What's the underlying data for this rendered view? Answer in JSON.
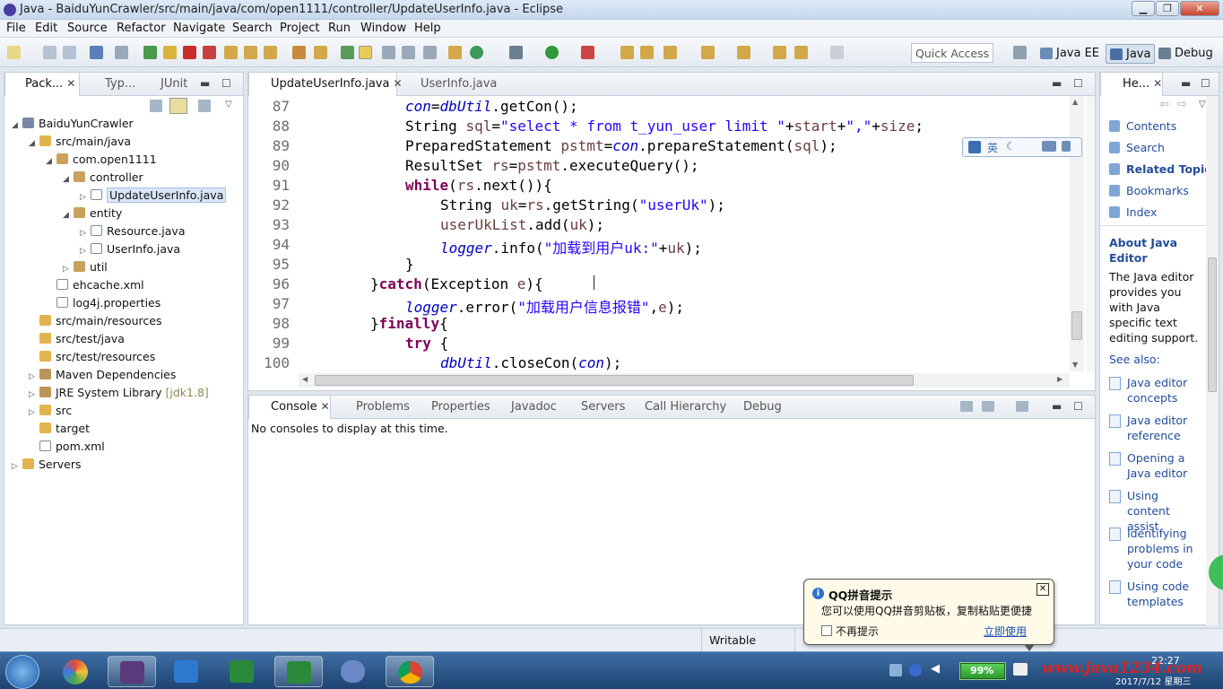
{
  "window": {
    "title": "Java - BaiduYunCrawler/src/main/java/com/open1111/controller/UpdateUserInfo.java - Eclipse"
  },
  "menu": [
    "File",
    "Edit",
    "Source",
    "Refactor",
    "Navigate",
    "Search",
    "Project",
    "Run",
    "Window",
    "Help"
  ],
  "toolbar": {
    "quick_access": "Quick Access",
    "perspectives": [
      "Java EE",
      "Java",
      "Debug"
    ]
  },
  "explorer": {
    "tabs": [
      "Pack...",
      "Typ...",
      "JUnit"
    ],
    "tree": [
      {
        "label": "BaiduYunCrawler",
        "depth": 0,
        "arrow": "open",
        "icon": "proj"
      },
      {
        "label": "src/main/java",
        "depth": 1,
        "arrow": "open",
        "icon": "folder"
      },
      {
        "label": "com.open1111",
        "depth": 2,
        "arrow": "open",
        "icon": "pkg"
      },
      {
        "label": "controller",
        "depth": 3,
        "arrow": "open",
        "icon": "pkg"
      },
      {
        "label": "UpdateUserInfo.java",
        "depth": 4,
        "arrow": "closed",
        "icon": "java",
        "selected": true
      },
      {
        "label": "entity",
        "depth": 3,
        "arrow": "open",
        "icon": "pkg"
      },
      {
        "label": "Resource.java",
        "depth": 4,
        "arrow": "closed",
        "icon": "java"
      },
      {
        "label": "UserInfo.java",
        "depth": 4,
        "arrow": "closed",
        "icon": "java"
      },
      {
        "label": "util",
        "depth": 3,
        "arrow": "closed",
        "icon": "pkg"
      },
      {
        "label": "ehcache.xml",
        "depth": 2,
        "arrow": "none",
        "icon": "xml"
      },
      {
        "label": "log4j.properties",
        "depth": 2,
        "arrow": "none",
        "icon": "xml"
      },
      {
        "label": "src/main/resources",
        "depth": 1,
        "arrow": "none",
        "icon": "folder"
      },
      {
        "label": "src/test/java",
        "depth": 1,
        "arrow": "none",
        "icon": "folder"
      },
      {
        "label": "src/test/resources",
        "depth": 1,
        "arrow": "none",
        "icon": "folder"
      },
      {
        "label": "Maven Dependencies",
        "depth": 1,
        "arrow": "closed",
        "icon": "lib"
      },
      {
        "label": "JRE System Library",
        "depth": 1,
        "arrow": "closed",
        "icon": "lib",
        "suffix": "[jdk1.8]"
      },
      {
        "label": "src",
        "depth": 1,
        "arrow": "closed",
        "icon": "folder"
      },
      {
        "label": "target",
        "depth": 1,
        "arrow": "none",
        "icon": "folder"
      },
      {
        "label": "pom.xml",
        "depth": 1,
        "arrow": "none",
        "icon": "xml"
      },
      {
        "label": "Servers",
        "depth": 0,
        "arrow": "closed",
        "icon": "folder"
      }
    ]
  },
  "editor": {
    "tabs": [
      "UpdateUserInfo.java",
      "UserInfo.java"
    ],
    "lines": [
      {
        "n": "87",
        "i": 3,
        "t": [
          [
            "f",
            "con"
          ],
          [
            "p",
            "="
          ],
          [
            "f",
            "dbUtil"
          ],
          [
            "p",
            ".getCon();"
          ]
        ]
      },
      {
        "n": "88",
        "i": 3,
        "t": [
          [
            "p",
            "String "
          ],
          [
            "v",
            "sql"
          ],
          [
            "p",
            "="
          ],
          [
            "s",
            "\"select * from t_yun_user limit \""
          ],
          [
            "p",
            "+"
          ],
          [
            "v",
            "start"
          ],
          [
            "p",
            "+"
          ],
          [
            "s",
            "\",\""
          ],
          [
            "p",
            "+"
          ],
          [
            "v",
            "size"
          ],
          [
            "p",
            ";"
          ]
        ]
      },
      {
        "n": "89",
        "i": 3,
        "t": [
          [
            "p",
            "PreparedStatement "
          ],
          [
            "v",
            "pstmt"
          ],
          [
            "p",
            "="
          ],
          [
            "f",
            "con"
          ],
          [
            "p",
            ".prepareStatement("
          ],
          [
            "v",
            "sql"
          ],
          [
            "p",
            ");"
          ]
        ]
      },
      {
        "n": "90",
        "i": 3,
        "t": [
          [
            "p",
            "ResultSet "
          ],
          [
            "v",
            "rs"
          ],
          [
            "p",
            "="
          ],
          [
            "v",
            "pstmt"
          ],
          [
            "p",
            ".executeQuery();"
          ]
        ]
      },
      {
        "n": "91",
        "i": 3,
        "t": [
          [
            "k",
            "while"
          ],
          [
            "p",
            "("
          ],
          [
            "v",
            "rs"
          ],
          [
            "p",
            ".next()){"
          ]
        ]
      },
      {
        "n": "92",
        "i": 4,
        "t": [
          [
            "p",
            "String "
          ],
          [
            "v",
            "uk"
          ],
          [
            "p",
            "="
          ],
          [
            "v",
            "rs"
          ],
          [
            "p",
            ".getString("
          ],
          [
            "s",
            "\"userUk\""
          ],
          [
            "p",
            ");"
          ]
        ]
      },
      {
        "n": "93",
        "i": 4,
        "t": [
          [
            "v",
            "userUkList"
          ],
          [
            "p",
            ".add("
          ],
          [
            "v",
            "uk"
          ],
          [
            "p",
            ");"
          ]
        ]
      },
      {
        "n": "94",
        "i": 4,
        "t": [
          [
            "f",
            "logger"
          ],
          [
            "p",
            ".info("
          ],
          [
            "s",
            "\"加载到用户uk:\""
          ],
          [
            "p",
            "+"
          ],
          [
            "v",
            "uk"
          ],
          [
            "p",
            ");"
          ]
        ]
      },
      {
        "n": "95",
        "i": 3,
        "t": [
          [
            "p",
            "}"
          ]
        ]
      },
      {
        "n": "96",
        "i": 2,
        "t": [
          [
            "p",
            "}"
          ],
          [
            "k",
            "catch"
          ],
          [
            "p",
            "(Exception "
          ],
          [
            "v",
            "e"
          ],
          [
            "p",
            "){"
          ]
        ]
      },
      {
        "n": "97",
        "i": 3,
        "t": [
          [
            "f",
            "logger"
          ],
          [
            "p",
            ".error("
          ],
          [
            "s",
            "\"加载用户信息报错\""
          ],
          [
            "p",
            ","
          ],
          [
            "v",
            "e"
          ],
          [
            "p",
            ");"
          ]
        ]
      },
      {
        "n": "98",
        "i": 2,
        "t": [
          [
            "p",
            "}"
          ],
          [
            "k",
            "finally"
          ],
          [
            "p",
            "{"
          ]
        ]
      },
      {
        "n": "99",
        "i": 3,
        "t": [
          [
            "k",
            "try"
          ],
          [
            "p",
            " {"
          ]
        ]
      },
      {
        "n": "100",
        "i": 4,
        "t": [
          [
            "f",
            "dbUtil"
          ],
          [
            "p",
            ".closeCon("
          ],
          [
            "f",
            "con"
          ],
          [
            "p",
            ");"
          ]
        ]
      }
    ]
  },
  "ime_toolbar": {
    "lang": "英"
  },
  "console": {
    "tabs": [
      "Console",
      "Problems",
      "Properties",
      "Javadoc",
      "Servers",
      "Call Hierarchy",
      "Debug"
    ],
    "message": "No consoles to display at this time."
  },
  "help": {
    "tab": "He...",
    "links": [
      "Contents",
      "Search",
      "Related Topics",
      "Bookmarks",
      "Index"
    ],
    "heading": "About Java Editor",
    "body": "The Java editor provides you with Java specific text editing support.",
    "see_also": "See also:",
    "topics": [
      "Java editor concepts",
      "Java editor reference",
      "Opening a Java editor",
      "Using content assist",
      "Identifying problems in your code",
      "Using code templates"
    ]
  },
  "status": {
    "mode": "Writable"
  },
  "qq_popup": {
    "title": "QQ拼音提示",
    "message": "您可以使用QQ拼音剪贴板，复制粘贴更便捷",
    "checkbox": "不再提示",
    "action": "立即使用"
  },
  "taskbar": {
    "battery": "99%",
    "time": "22:27",
    "date": "2017/7/12 星期三",
    "watermark": "www.java1234.com"
  },
  "colors": {
    "keyword": "#7f0055",
    "field": "#0000c0",
    "string": "#2a00ff",
    "local": "#6a3e3e"
  }
}
